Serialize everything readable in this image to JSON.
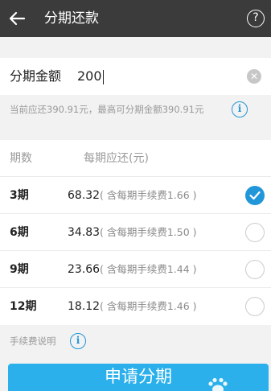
{
  "header": {
    "title": "分期还款",
    "back_icon": "arrow-left-icon",
    "help_icon": "question-circle-icon",
    "help_glyph": "?"
  },
  "amount": {
    "label": "分期金额",
    "value": "200",
    "clear_icon": "clear-circle-icon",
    "clear_glyph": "✕"
  },
  "note": {
    "text": "当前应还390.91元，最高可分期金额390.91元",
    "info_glyph": "i"
  },
  "list": {
    "header_periods": "期数",
    "header_payment": "每期应还(元)",
    "rows": [
      {
        "period": "3期",
        "amount": "68.32",
        "fee": "( 含每期手续费1.66 )",
        "selected": true
      },
      {
        "period": "6期",
        "amount": "34.83",
        "fee": "( 含每期手续费1.50 )",
        "selected": false
      },
      {
        "period": "9期",
        "amount": "23.66",
        "fee": "( 含每期手续费1.44 )",
        "selected": false
      },
      {
        "period": "12期",
        "amount": "18.12",
        "fee": "( 含每期手续费1.46 )",
        "selected": false
      }
    ]
  },
  "fee_note": {
    "text": "手续费说明",
    "info_glyph": "i"
  },
  "apply_button": {
    "label": "申请分期"
  },
  "colors": {
    "topbar": "#3b3b3b",
    "accent": "#2196d8",
    "button": "#2bb0eb",
    "background": "#f2f2f2"
  }
}
